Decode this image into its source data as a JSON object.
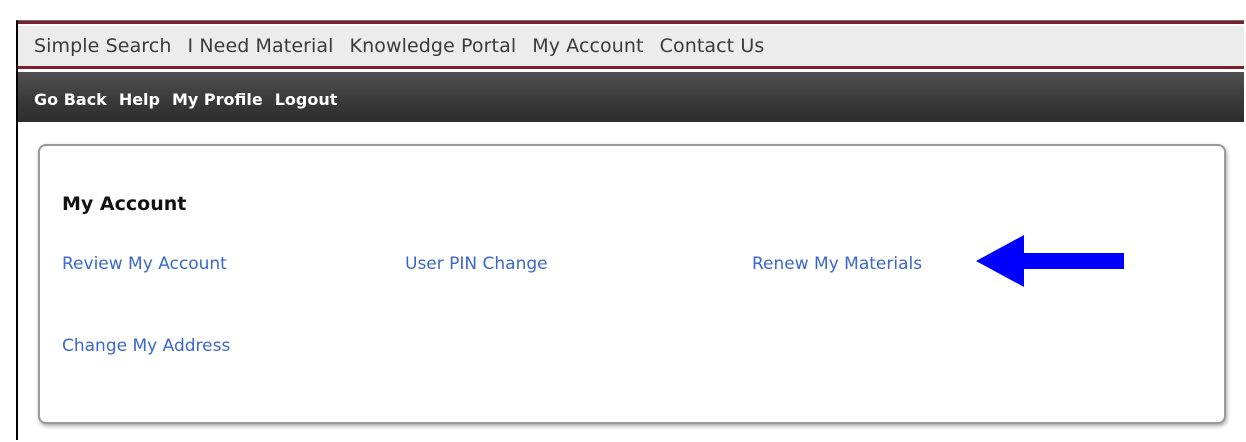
{
  "top_nav": {
    "items": [
      "Simple Search",
      "I Need Material",
      "Knowledge Portal",
      "My Account",
      "Contact Us"
    ]
  },
  "sub_nav": {
    "items": [
      "Go Back",
      "Help",
      "My Profile",
      "Logout"
    ]
  },
  "panel": {
    "title": "My Account",
    "links": {
      "review_account": "Review My Account",
      "pin_change": "User PIN Change",
      "renew_materials": "Renew My Materials",
      "change_address": "Change My Address"
    }
  },
  "colors": {
    "accent_maroon": "#7a1f2b",
    "link_blue": "#3a67c8",
    "arrow_blue": "#0000ff"
  },
  "icons": {
    "annotation": "left-arrow-icon"
  }
}
